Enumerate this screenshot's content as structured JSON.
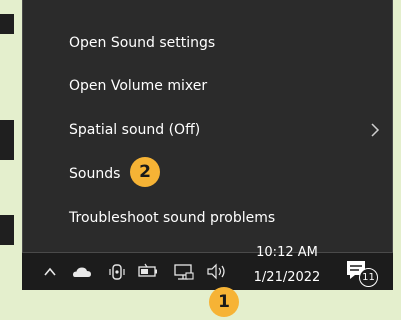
{
  "menu": {
    "items": [
      {
        "label": "Open Sound settings"
      },
      {
        "label": "Open Volume mixer"
      },
      {
        "label": "Spatial sound (Off)",
        "has_submenu": true
      },
      {
        "label": "Sounds"
      },
      {
        "label": "Troubleshoot sound problems"
      }
    ]
  },
  "badges": {
    "step1": "1",
    "step2": "2"
  },
  "taskbar": {
    "time": "10:12 AM",
    "date": "1/21/2022",
    "notification_count": "11"
  },
  "icons": [
    "chevron-up-icon",
    "onedrive-cloud-icon",
    "touch-keyboard-icon",
    "battery-icon",
    "network-icon",
    "speaker-icon",
    "action-center-icon"
  ],
  "colors": {
    "menu_bg": "#2b2b2b",
    "taskbar_bg": "#1c1c1c",
    "badge": "#f6b335",
    "backdrop": "#e4efcd"
  }
}
